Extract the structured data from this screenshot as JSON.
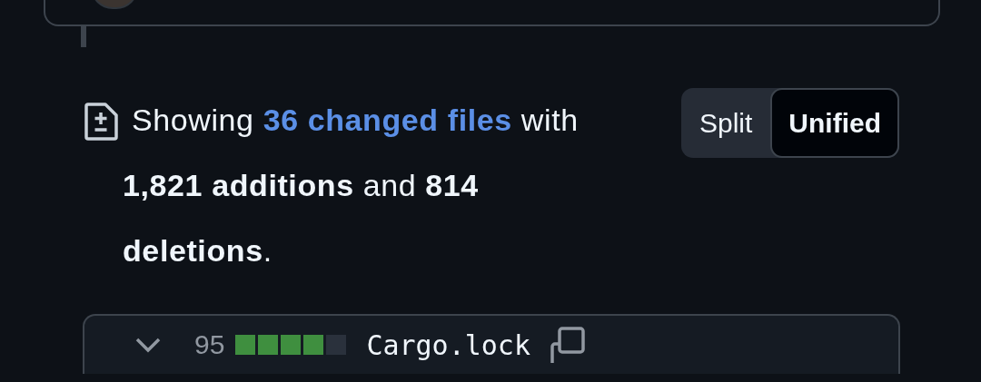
{
  "summary": {
    "prefix": "Showing",
    "link": "36 changed files",
    "suffix": "with **1,821 additions** and **814 deletions**."
  },
  "view_toggle": [
    {
      "label": "Split",
      "selected": false
    },
    {
      "label": "Unified",
      "selected": true
    }
  ],
  "file": {
    "expanded": true,
    "changes": "95",
    "diffstat": [
      {
        "kind": "added"
      },
      {
        "kind": "added"
      },
      {
        "kind": "added"
      },
      {
        "kind": "added"
      },
      {
        "kind": "neutral"
      }
    ],
    "name": "Cargo.lock"
  }
}
